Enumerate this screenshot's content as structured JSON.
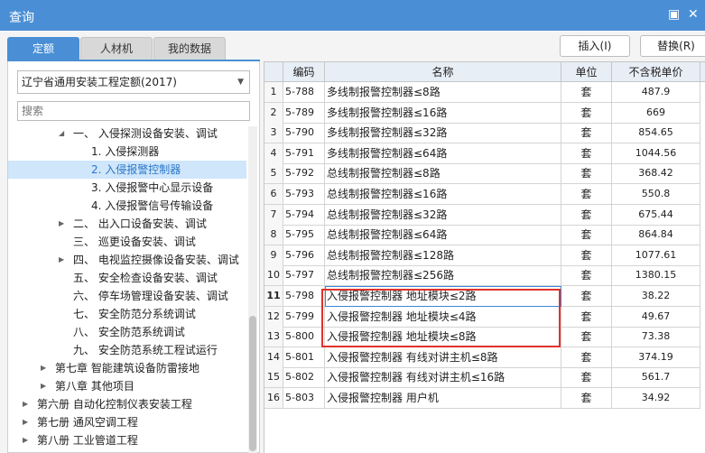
{
  "window": {
    "title": "查询",
    "max_glyph": "▣",
    "close_glyph": "✕"
  },
  "tabs": [
    {
      "label": "定额",
      "active": true
    },
    {
      "label": "人材机",
      "active": false
    },
    {
      "label": "我的数据",
      "active": false
    }
  ],
  "actions": {
    "insert_label": "插入(I)",
    "replace_label": "替换(R)"
  },
  "left": {
    "library_select": "辽宁省通用安装工程定额(2017)",
    "search_placeholder": "搜索",
    "tree": [
      {
        "arrow": "◢",
        "label": "一、 入侵探测设备安装、调试",
        "selected": false
      },
      {
        "arrow": "",
        "label": "1. 入侵探测器",
        "selected": false
      },
      {
        "arrow": "",
        "label": "2. 入侵报警控制器",
        "selected": true
      },
      {
        "arrow": "",
        "label": "3. 入侵报警中心显示设备",
        "selected": false
      },
      {
        "arrow": "",
        "label": "4. 入侵报警信号传输设备",
        "selected": false
      },
      {
        "arrow": "▶",
        "label": "二、 出入口设备安装、调试",
        "selected": false
      },
      {
        "arrow": "",
        "label": "三、 巡更设备安装、调试",
        "selected": false
      },
      {
        "arrow": "▶",
        "label": "四、 电视监控摄像设备安装、调试",
        "selected": false
      },
      {
        "arrow": "",
        "label": "五、 安全检查设备安装、调试",
        "selected": false
      },
      {
        "arrow": "",
        "label": "六、 停车场管理设备安装、调试",
        "selected": false
      },
      {
        "arrow": "",
        "label": "七、 安全防范分系统调试",
        "selected": false
      },
      {
        "arrow": "",
        "label": "八、 安全防范系统调试",
        "selected": false
      },
      {
        "arrow": "",
        "label": "九、 安全防范系统工程试运行",
        "selected": false
      },
      {
        "arrow": "▶",
        "label": "第七章 智能建筑设备防雷接地",
        "selected": false
      },
      {
        "arrow": "▶",
        "label": "第八章 其他项目",
        "selected": false
      },
      {
        "arrow": "▶",
        "label": "第六册 自动化控制仪表安装工程",
        "selected": false
      },
      {
        "arrow": "▶",
        "label": "第七册 通风空调工程",
        "selected": false
      },
      {
        "arrow": "▶",
        "label": "第八册 工业管道工程",
        "selected": false
      }
    ]
  },
  "table": {
    "headers": {
      "code": "编码",
      "name": "名称",
      "unit": "单位",
      "price": "不含税单价"
    },
    "rows": [
      {
        "n": "1",
        "code": "5-788",
        "name": "多线制报警控制器≤8路",
        "unit": "套",
        "price": "487.9"
      },
      {
        "n": "2",
        "code": "5-789",
        "name": "多线制报警控制器≤16路",
        "unit": "套",
        "price": "669"
      },
      {
        "n": "3",
        "code": "5-790",
        "name": "多线制报警控制器≤32路",
        "unit": "套",
        "price": "854.65"
      },
      {
        "n": "4",
        "code": "5-791",
        "name": "多线制报警控制器≤64路",
        "unit": "套",
        "price": "1044.56"
      },
      {
        "n": "5",
        "code": "5-792",
        "name": "总线制报警控制器≤8路",
        "unit": "套",
        "price": "368.42"
      },
      {
        "n": "6",
        "code": "5-793",
        "name": "总线制报警控制器≤16路",
        "unit": "套",
        "price": "550.8"
      },
      {
        "n": "7",
        "code": "5-794",
        "name": "总线制报警控制器≤32路",
        "unit": "套",
        "price": "675.44"
      },
      {
        "n": "8",
        "code": "5-795",
        "name": "总线制报警控制器≤64路",
        "unit": "套",
        "price": "864.84"
      },
      {
        "n": "9",
        "code": "5-796",
        "name": "总线制报警控制器≤128路",
        "unit": "套",
        "price": "1077.61"
      },
      {
        "n": "10",
        "code": "5-797",
        "name": "总线制报警控制器≤256路",
        "unit": "套",
        "price": "1380.15"
      },
      {
        "n": "11",
        "code": "5-798",
        "name": "入侵报警控制器 地址模块≤2路",
        "unit": "套",
        "price": "38.22"
      },
      {
        "n": "12",
        "code": "5-799",
        "name": "入侵报警控制器 地址模块≤4路",
        "unit": "套",
        "price": "49.67"
      },
      {
        "n": "13",
        "code": "5-800",
        "name": "入侵报警控制器 地址模块≤8路",
        "unit": "套",
        "price": "73.38"
      },
      {
        "n": "14",
        "code": "5-801",
        "name": "入侵报警控制器 有线对讲主机≤8路",
        "unit": "套",
        "price": "374.19"
      },
      {
        "n": "15",
        "code": "5-802",
        "name": "入侵报警控制器 有线对讲主机≤16路",
        "unit": "套",
        "price": "561.7"
      },
      {
        "n": "16",
        "code": "5-803",
        "name": "入侵报警控制器 用户机",
        "unit": "套",
        "price": "34.92"
      }
    ]
  },
  "colors": {
    "titlebar": "#4a8fd6",
    "selected_bg": "#cfe6fb",
    "highlight_box": "#e0322a"
  },
  "icons": {
    "maximize": "maximize-icon",
    "close": "close-icon",
    "tree_expand": "triangle-right-icon",
    "tree_expanded": "triangle-down-icon",
    "dropdown": "chevron-down-icon"
  }
}
